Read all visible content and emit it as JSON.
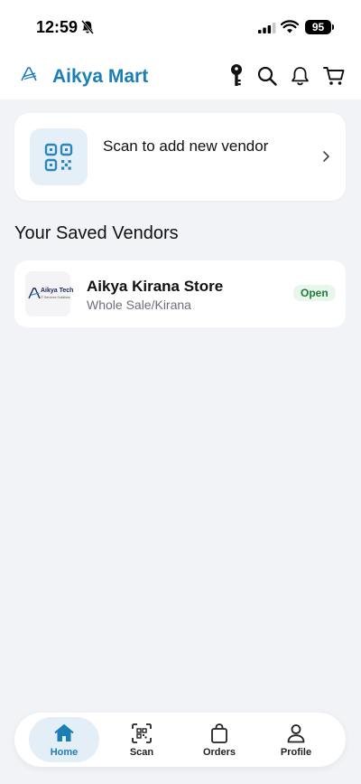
{
  "status_bar": {
    "time": "12:59",
    "battery": "95",
    "icons": [
      "bell-slash-icon",
      "signal-icon",
      "wifi-icon",
      "battery-icon"
    ]
  },
  "header": {
    "title": "Aikya Mart",
    "icons": [
      "key-icon",
      "search-icon",
      "bell-icon",
      "cart-icon"
    ],
    "accent_color": "#1b7fb6"
  },
  "scan_card": {
    "label": "Scan to add new vendor",
    "icon": "qr-code-icon"
  },
  "saved_vendors": {
    "title": "Your Saved Vendors",
    "items": [
      {
        "name": "Aikya Kirana Store",
        "category": "Whole Sale/Kirana",
        "status": "Open",
        "logo_text": "Aikya Tech",
        "logo_subtext": "IT Services Solutions"
      }
    ]
  },
  "bottom_nav": {
    "items": [
      {
        "label": "Home",
        "icon": "home-icon",
        "active": true
      },
      {
        "label": "Scan",
        "icon": "scan-icon",
        "active": false
      },
      {
        "label": "Orders",
        "icon": "shopping-bag-icon",
        "active": false
      },
      {
        "label": "Profile",
        "icon": "user-icon",
        "active": false
      }
    ]
  },
  "colors": {
    "background": "#f2f3f7",
    "status_open_bg": "#e8f6ec",
    "status_open_text": "#1f7a3a"
  }
}
